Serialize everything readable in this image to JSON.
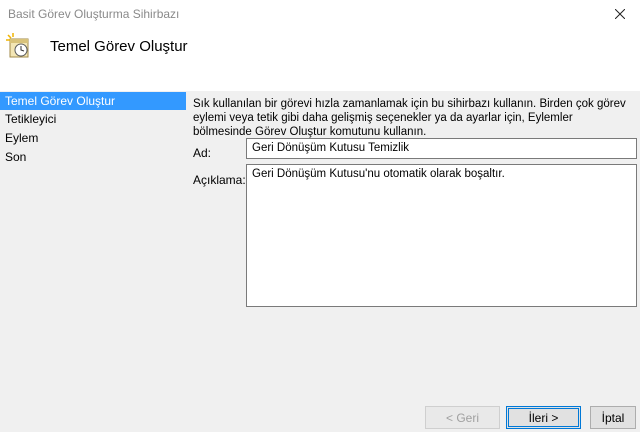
{
  "window": {
    "title": "Basit Görev Oluşturma Sihirbazı"
  },
  "header": {
    "heading": "Temel Görev Oluştur",
    "icon": "task-clock-icon"
  },
  "sidebar": {
    "items": [
      {
        "label": "Temel Görev Oluştur",
        "active": true
      },
      {
        "label": "Tetikleyici"
      },
      {
        "label": "Eylem"
      },
      {
        "label": "Son"
      }
    ]
  },
  "main": {
    "description": "Sık kullanılan bir görevi hızla zamanlamak için bu sihirbazı kullanın. Birden çok görev eylemi veya tetik gibi daha gelişmiş seçenekler ya da ayarlar için, Eylemler bölmesinde Görev Oluştur komutunu kullanın.",
    "name_label": "Ad:",
    "name_value": "Geri Dönüşüm Kutusu Temizlik",
    "desc_label": "Açıklama:",
    "desc_value": "Geri Dönüşüm Kutusu'nu otomatik olarak boşaltır."
  },
  "buttons": {
    "back": "< Geri",
    "next": "İleri >",
    "cancel": "İptal"
  },
  "colors": {
    "accent": "#3399ff",
    "panel": "#f0f0f0"
  }
}
